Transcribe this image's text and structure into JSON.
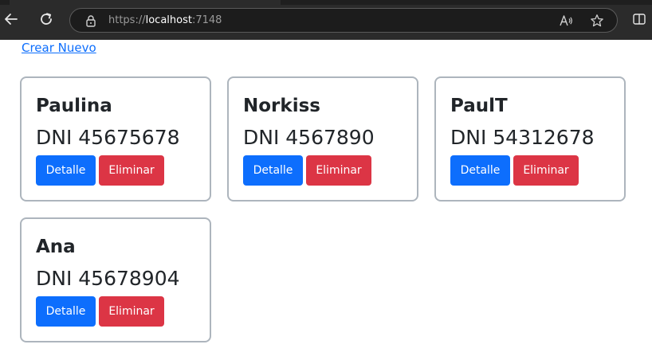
{
  "browser": {
    "url_scheme": "https://",
    "url_host": "localhost",
    "url_port": ":7148"
  },
  "page": {
    "create_link": "Crear Nuevo"
  },
  "cards": [
    {
      "name": "Paulina",
      "dni": "DNI 45675678",
      "detail_label": "Detalle",
      "delete_label": "Eliminar"
    },
    {
      "name": "Norkiss",
      "dni": "DNI 4567890",
      "detail_label": "Detalle",
      "delete_label": "Eliminar"
    },
    {
      "name": "PaulT",
      "dni": "DNI 54312678",
      "detail_label": "Detalle",
      "delete_label": "Eliminar"
    },
    {
      "name": "Ana",
      "dni": "DNI 45678904",
      "detail_label": "Detalle",
      "delete_label": "Eliminar"
    }
  ],
  "colors": {
    "primary": "#0d6efd",
    "danger": "#dc3545",
    "card_border": "#adb5bd",
    "text": "#212529"
  }
}
